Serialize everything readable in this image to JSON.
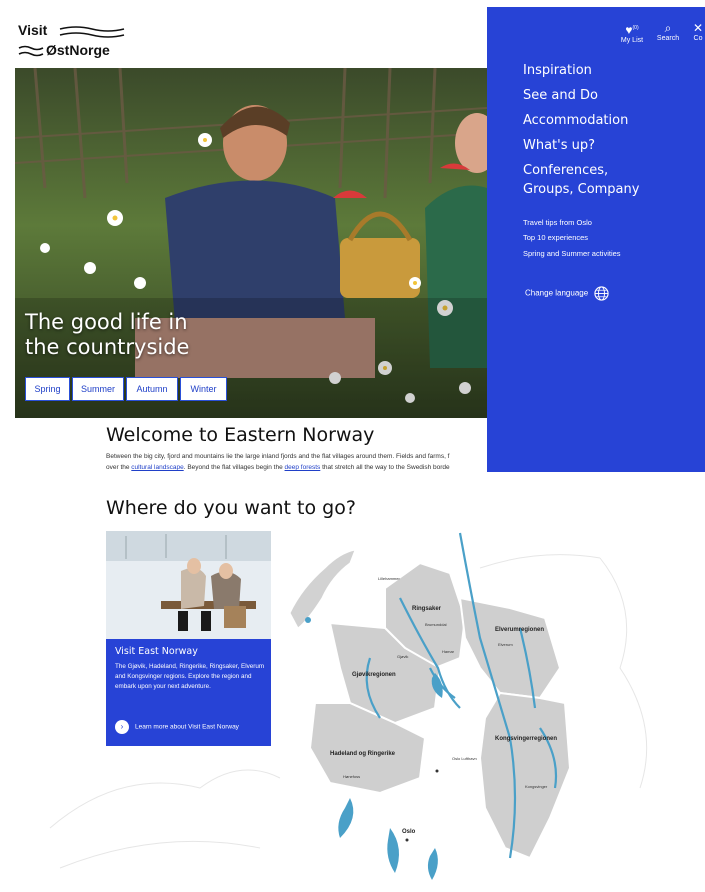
{
  "logo": {
    "line1": "Visit",
    "line2": "ØstNorge"
  },
  "hero": {
    "title_line1": "The good life in",
    "title_line2": "the countryside",
    "seasons": [
      "Spring",
      "Summer",
      "Autumn",
      "Winter"
    ]
  },
  "menu": {
    "top": {
      "mylist": "My List",
      "mylist_count": "(0)",
      "search": "Search",
      "close": "Co"
    },
    "items": [
      "Inspiration",
      "See and Do",
      "Accommodation",
      "What's up?",
      "Conferences,",
      "Groups, Company"
    ],
    "sub_items": [
      "Travel tips from Oslo",
      "Top 10 experiences",
      "Spring and Summer activities"
    ],
    "change_language": "Change language"
  },
  "welcome": {
    "heading": "Welcome to Eastern Norway",
    "text1": "Between the big city, fjord and mountains lie the large inland fjords and the flat villages around them. Fields and farms, f",
    "text2_pre": "over the ",
    "link1": "cultural landscape",
    "text2_mid": ". Beyond the flat villages begin the ",
    "link2": "deep forests",
    "text2_post": " that stretch all the way to the Swedish borde"
  },
  "where": {
    "heading": "Where do you want to go?"
  },
  "card": {
    "title": "Visit East Norway",
    "text": "The Gjøvik, Hadeland, Ringerike, Ringsaker, Elverum and Kongsvinger regions. Explore the region and embark upon your next adventure.",
    "link": "Learn more about Visit East Norway"
  },
  "map": {
    "regions": [
      "Ringsaker",
      "Elverumregionen",
      "Gjøvikregionen",
      "Hadeland og Ringerike",
      "Kongsvingerregionen"
    ],
    "towns": [
      "Lillehammer",
      "Brumunddal",
      "Gjøvik",
      "Hamar",
      "Elverum",
      "Hønefoss",
      "Kongsvinger",
      "Oslo",
      "Oslo Lufthavn"
    ]
  },
  "colors": {
    "brand_blue": "#2743d6",
    "region_gray": "#cfcfcf",
    "water": "#4aa0c8"
  }
}
